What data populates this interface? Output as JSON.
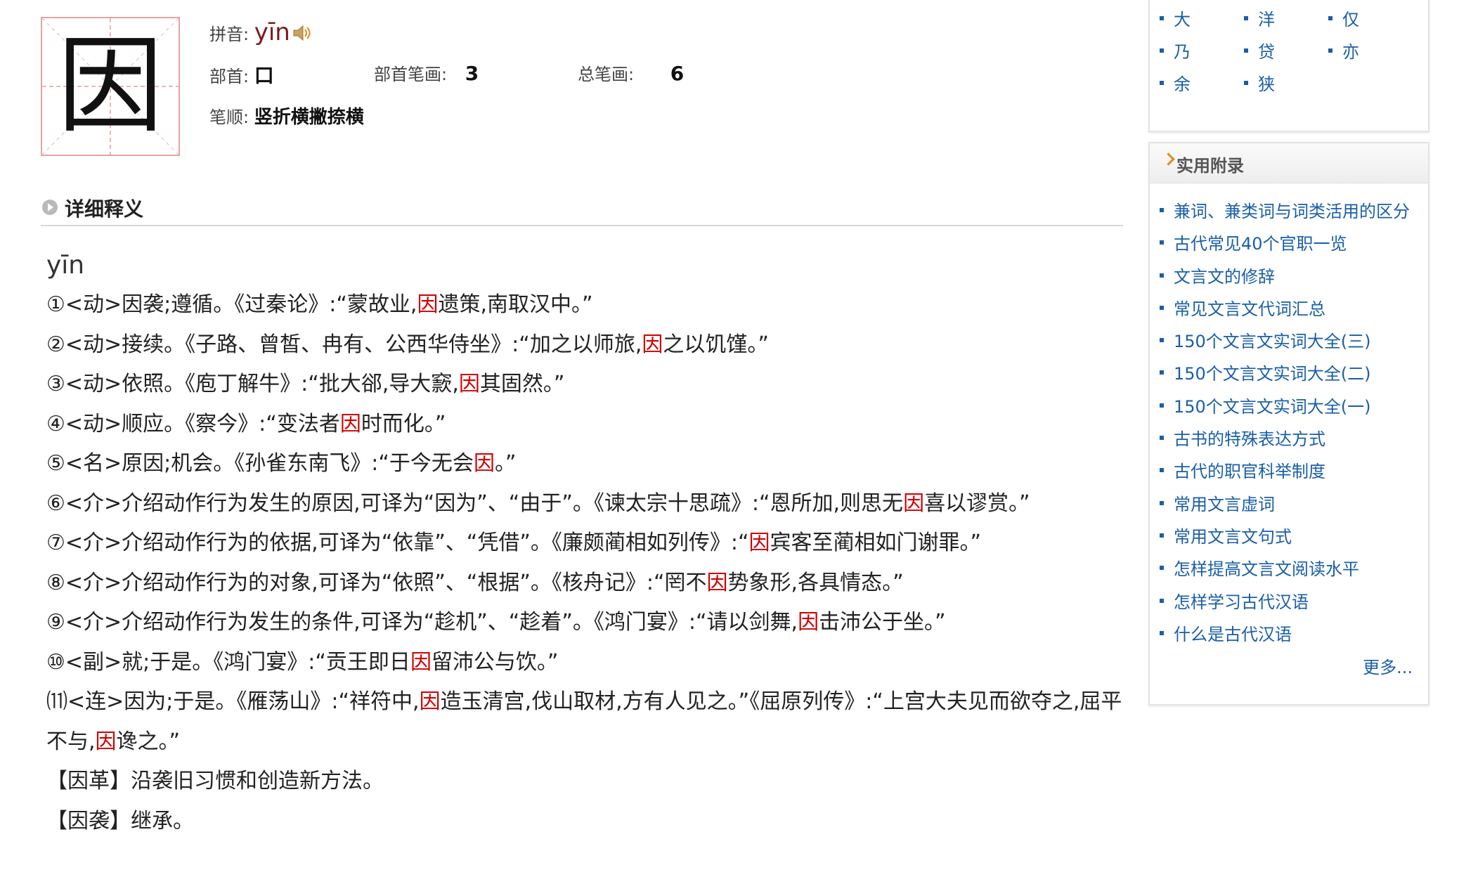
{
  "character": {
    "glyph": "因"
  },
  "info": {
    "pinyin_label": "拼音:",
    "pinyin_value": "yīn",
    "radical_label": "部首:",
    "radical_value": "口",
    "radical_strokes_label": "部首笔画:",
    "radical_strokes_value": "3",
    "total_strokes_label": "总笔画:",
    "total_strokes_value": "6",
    "stroke_order_label": "笔顺:",
    "stroke_order_value": "竖折横撇捺横"
  },
  "section": {
    "title": "详细释义"
  },
  "definitions": {
    "pinyin": "yīn",
    "lines": [
      [
        "①<动>因袭;遵循。《过秦论》:“蒙故业,",
        "因",
        "遗策,南取汉中。”"
      ],
      [
        "②<动>接续。《子路、曾皙、冉有、公西华侍坐》:“加之以师旅,",
        "因",
        "之以饥馑。”"
      ],
      [
        "③<动>依照。《庖丁解牛》:“批大郤,导大窾,",
        "因",
        "其固然。”"
      ],
      [
        "④<动>顺应。《察今》:“变法者",
        "因",
        "时而化。”"
      ],
      [
        "⑤<名>原因;机会。《孙雀东南飞》:“于今无会",
        "因",
        "。”"
      ],
      [
        "⑥<介>介绍动作行为发生的原因,可译为“因为”、“由于”。《谏太宗十思疏》:“恩所加,则思无",
        "因",
        "喜以谬赏。”"
      ],
      [
        "⑦<介>介绍动作行为的依据,可译为“依靠”、“凭借”。《廉颇蔺相如列传》:“",
        "因",
        "宾客至蔺相如门谢罪。”"
      ],
      [
        "⑧<介>介绍动作行为的对象,可译为“依照”、“根据”。《核舟记》:“罔不",
        "因",
        "势象形,各具情态。”"
      ],
      [
        "⑨<介>介绍动作行为发生的条件,可译为“趁机”、“趁着”。《鸿门宴》:“请以剑舞,",
        "因",
        "击沛公于坐。”"
      ],
      [
        "⑩<副>就;于是。《鸿门宴》:“贡王即日",
        "因",
        "留沛公与饮。”"
      ],
      [
        "⑾<连>因为;于是。《雁荡山》:“祥符中,",
        "因",
        "造玉清宫,伐山取材,方有人见之。”《屈原列传》:“上宫大夫见而欲夺之,屈平不与,",
        "因",
        "谗之。”"
      ]
    ],
    "idioms": [
      "【因革】沿袭旧习惯和创造新方法。",
      "【因袭】继承。"
    ]
  },
  "sidebar": {
    "related_chars": [
      "大",
      "洋",
      "仅",
      "乃",
      "贷",
      "亦",
      "余",
      "狭"
    ],
    "appendix_title": "实用附录",
    "links": [
      "兼词、兼类词与词类活用的区分",
      "古代常见40个官职一览",
      "文言文的修辞",
      "常见文言文代词汇总",
      "150个文言文实词大全(三)",
      "150个文言文实词大全(二)",
      "150个文言文实词大全(一)",
      "古书的特殊表达方式",
      "古代的职官科举制度",
      "常用文言虚词",
      "常用文言文句式",
      "怎样提高文言文阅读水平",
      "怎样学习古代汉语",
      "什么是古代汉语"
    ],
    "more_label": "更多..."
  },
  "colors": {
    "highlight": "#d10000",
    "link": "#1a5ea8",
    "pinyin": "#7a1c1c",
    "grid_border": "#e4a3a3"
  }
}
